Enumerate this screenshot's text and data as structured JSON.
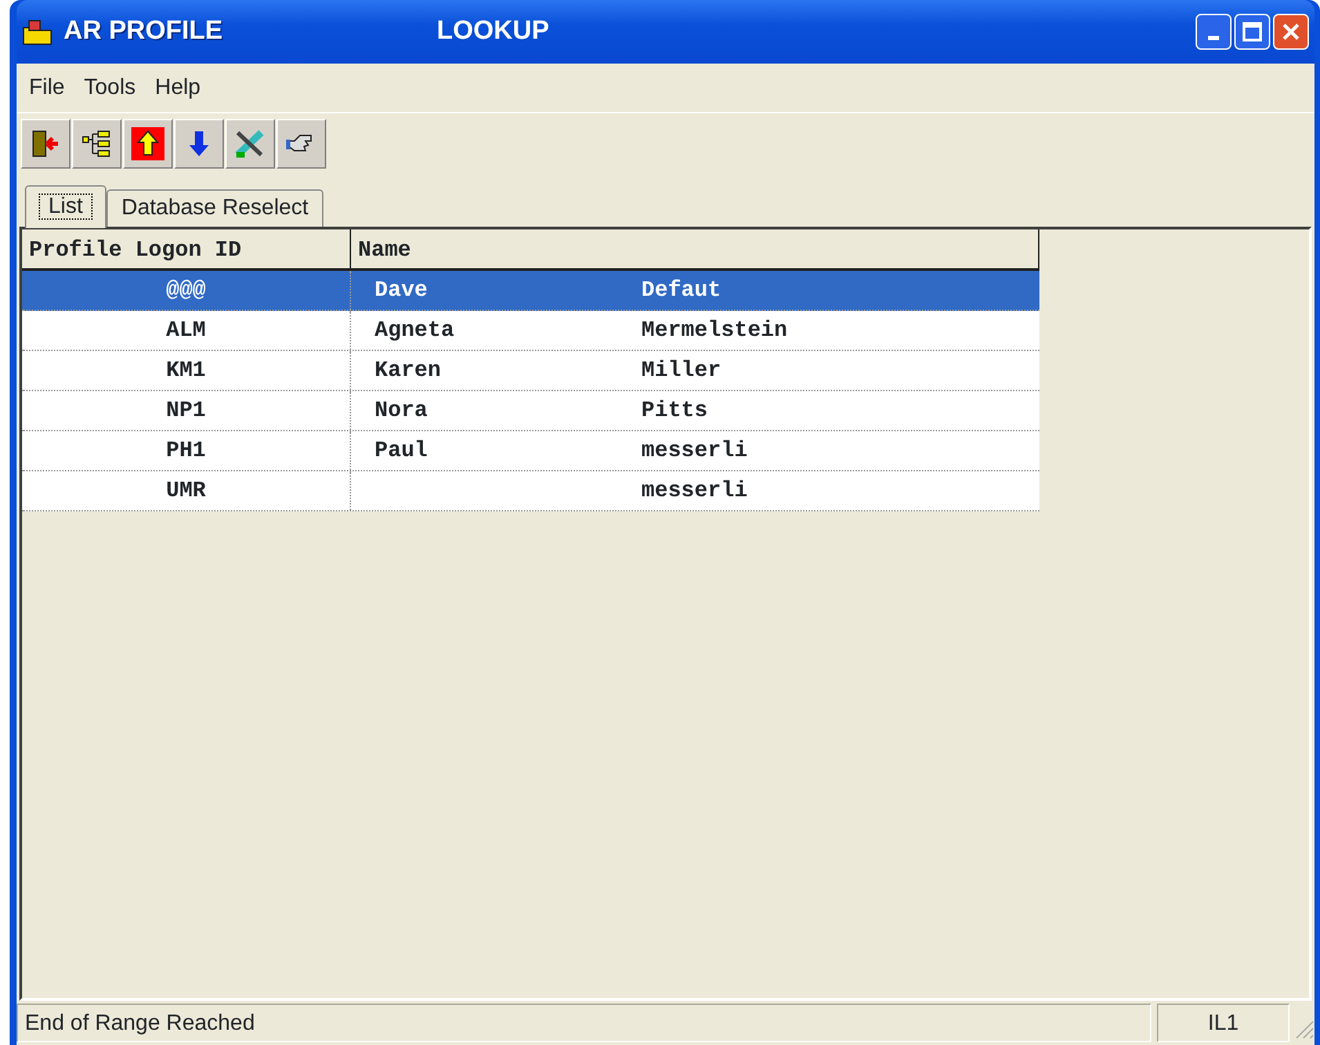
{
  "window": {
    "title": "AR PROFILE",
    "subtitle": "LOOKUP"
  },
  "menu": [
    "File",
    "Tools",
    "Help"
  ],
  "toolbar": [
    {
      "kind": "exit"
    },
    {
      "kind": "tree"
    },
    {
      "kind": "up"
    },
    {
      "kind": "down"
    },
    {
      "kind": "tools"
    },
    {
      "kind": "hand"
    }
  ],
  "tabs": [
    {
      "label": "List",
      "selected": true
    },
    {
      "label": "Database Reselect",
      "selected": false
    }
  ],
  "table": {
    "columns": [
      "Profile Logon ID",
      "Name"
    ],
    "rows": [
      {
        "id": "@@@",
        "first": "Dave",
        "last": "Defaut",
        "selected": true
      },
      {
        "id": "ALM",
        "first": "Agneta",
        "last": "Mermelstein",
        "selected": false
      },
      {
        "id": "KM1",
        "first": "Karen",
        "last": "Miller",
        "selected": false
      },
      {
        "id": "NP1",
        "first": "Nora",
        "last": "Pitts",
        "selected": false
      },
      {
        "id": "PH1",
        "first": "Paul",
        "last": "messerli",
        "selected": false
      },
      {
        "id": "UMR",
        "first": "",
        "last": "messerli",
        "selected": false
      }
    ]
  },
  "status_bar": {
    "message": "End of Range Reached",
    "code": "IL1"
  }
}
